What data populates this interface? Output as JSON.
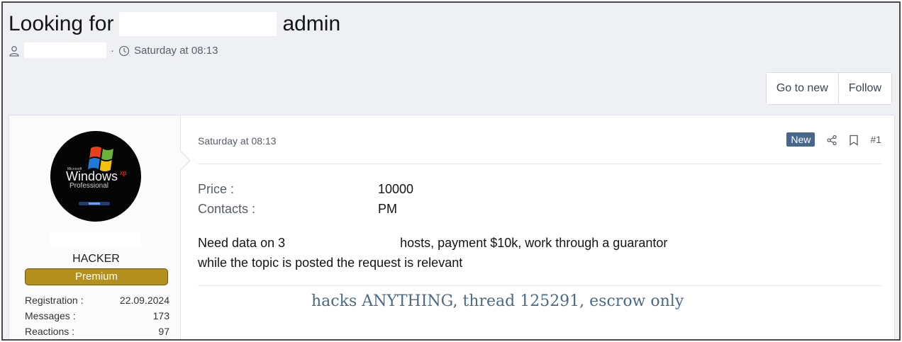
{
  "thread": {
    "title_prefix": "Looking for",
    "title_suffix": "admin",
    "timestamp": "Saturday at 08:13"
  },
  "buttons": {
    "go_to_new": "Go to new",
    "follow": "Follow"
  },
  "user": {
    "avatar_text_small": "Microsoft",
    "avatar_text_main": "Windows",
    "avatar_text_xp": "xp",
    "avatar_text_sub": "Professional",
    "title": "HACKER",
    "banner": "Premium",
    "stats": [
      {
        "label": "Registration :",
        "value": "22.09.2024"
      },
      {
        "label": "Messages :",
        "value": "173"
      },
      {
        "label": "Reactions :",
        "value": "97"
      }
    ]
  },
  "post": {
    "date": "Saturday at 08:13",
    "badge": "New",
    "number": "#1",
    "fields": [
      {
        "label": "Price :",
        "value": "10000"
      },
      {
        "label": "Contacts :",
        "value": "PM"
      }
    ],
    "body_line1_a": "Need data on 3",
    "body_line1_b": "hosts, payment $10k, work through a guarantor",
    "body_line2": "while the topic is posted the request is relevant",
    "signature": "hacks ANYTHING, thread 125291, escrow only"
  },
  "colors": {
    "badge_bg": "#47678d",
    "banner_bg": "#b38f1d",
    "signature": "#4a6a86"
  }
}
